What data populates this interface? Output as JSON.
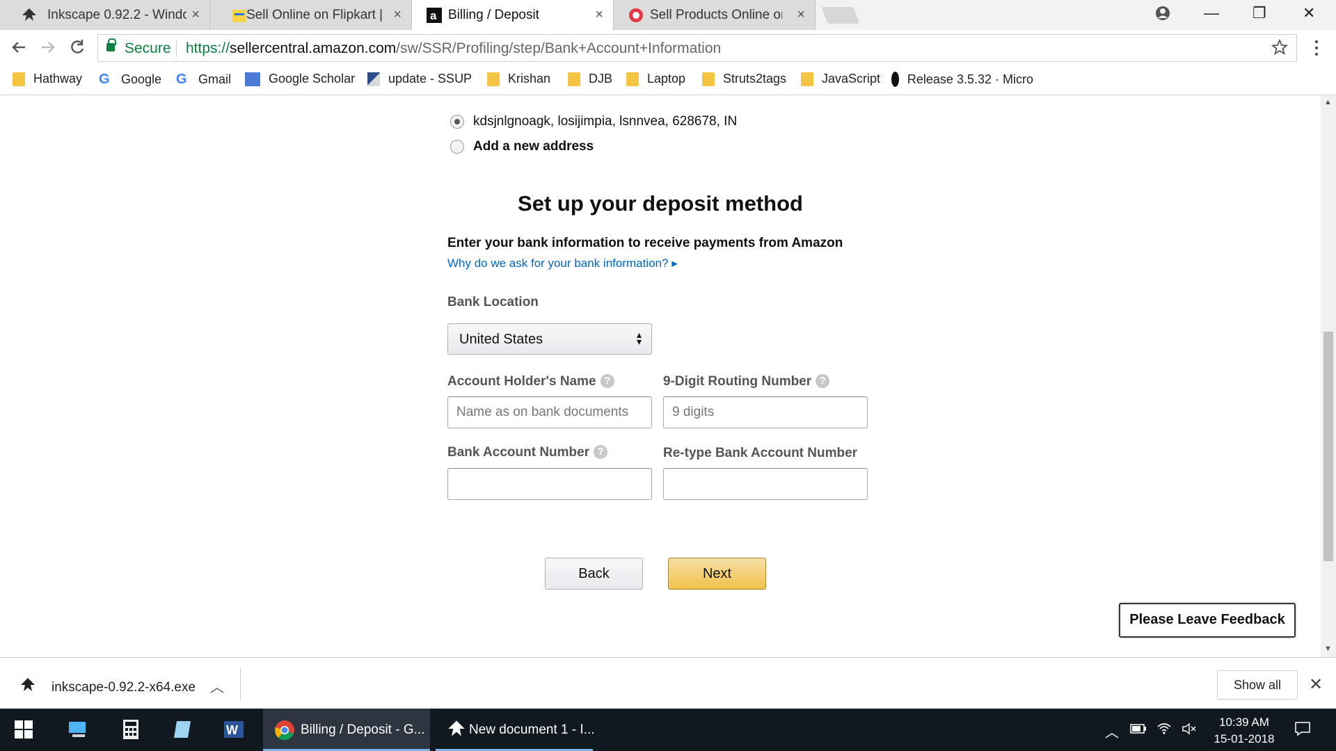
{
  "browser": {
    "tabs": [
      {
        "label": "Inkscape 0.92.2 - Window",
        "close": "×"
      },
      {
        "label": "Sell Online on Flipkart | O",
        "close": "×"
      },
      {
        "label": "Billing / Deposit",
        "close": "×"
      },
      {
        "label": "Sell Products Online on S",
        "close": "×"
      }
    ],
    "window_controls": {
      "minimize": "—",
      "restore": "❐",
      "close": "✕"
    },
    "secure_label": "Secure",
    "url_scheme": "https://",
    "url_host": "sellercentral.amazon.com",
    "url_path": "/sw/SSR/Profiling/step/Bank+Account+Information",
    "bookmarks": [
      {
        "label": "Hathway",
        "icon": "folder-icon"
      },
      {
        "label": "Google",
        "icon": "google-icon"
      },
      {
        "label": "Gmail",
        "icon": "google-icon"
      },
      {
        "label": "Google Scholar",
        "icon": "scholar-icon"
      },
      {
        "label": "update - SSUP",
        "icon": "page-icon"
      },
      {
        "label": "Krishan",
        "icon": "folder-icon"
      },
      {
        "label": "DJB",
        "icon": "folder-icon"
      },
      {
        "label": "Laptop",
        "icon": "folder-icon"
      },
      {
        "label": "Struts2tags",
        "icon": "folder-icon"
      },
      {
        "label": "JavaScript",
        "icon": "folder-icon"
      },
      {
        "label": "Release 3.5.32 · Micro",
        "icon": "github-icon"
      }
    ]
  },
  "page": {
    "addresses": [
      {
        "label": "kdsjnlgnoagk, losijimpia, lsnnvea, 628678, IN",
        "checked": true
      },
      {
        "label": "Add a new address",
        "checked": false
      }
    ],
    "heading": "Set up your deposit method",
    "intro": "Enter your bank information to receive payments from Amazon",
    "why_link": "Why do we ask for your bank information? ▸",
    "bank_location": {
      "label": "Bank Location",
      "value": "United States"
    },
    "account_holder": {
      "label": "Account Holder's Name",
      "placeholder": "Name as on bank documents",
      "value": ""
    },
    "routing": {
      "label": "9-Digit Routing Number",
      "placeholder": "9 digits",
      "value": ""
    },
    "account_number": {
      "label": "Bank Account Number",
      "value": ""
    },
    "retype_account": {
      "label": "Re-type Bank Account Number",
      "value": ""
    },
    "back_label": "Back",
    "next_label": "Next",
    "feedback_label": "Please Leave Feedback",
    "colors": {
      "link": "#0066c0",
      "next_button": "#f0c14b"
    }
  },
  "downloads": {
    "filename": "inkscape-0.92.2-x64.exe",
    "show_all": "Show all"
  },
  "taskbar": {
    "apps": [
      {
        "label": "Billing / Deposit - G..."
      },
      {
        "label": "New document 1 - I..."
      }
    ],
    "time": "10:39 AM",
    "date": "15-01-2018"
  }
}
